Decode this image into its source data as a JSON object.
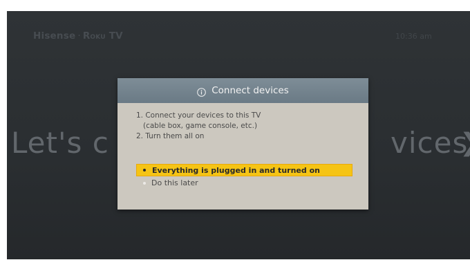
{
  "header": {
    "brand_name": "Hisense",
    "brand_separator": "·",
    "platform_name": "Roku TV",
    "clock": "10:36 am"
  },
  "background": {
    "heading_left": "Let's c",
    "heading_right": "vices",
    "chevron": "❯"
  },
  "dialog": {
    "icon": "info-icon",
    "title": "Connect devices",
    "instructions": [
      "1. Connect your devices to this TV",
      "(cable box, game console, etc.)",
      "2. Turn them all on"
    ],
    "options": [
      {
        "label": "Everything is plugged in and turned on",
        "selected": true
      },
      {
        "label": "Do this later",
        "selected": false
      }
    ]
  },
  "colors": {
    "screen_bg": "#2c3033",
    "dialog_bg": "#ccc8bf",
    "dialog_header": "#74848f",
    "highlight": "#f5c415"
  }
}
